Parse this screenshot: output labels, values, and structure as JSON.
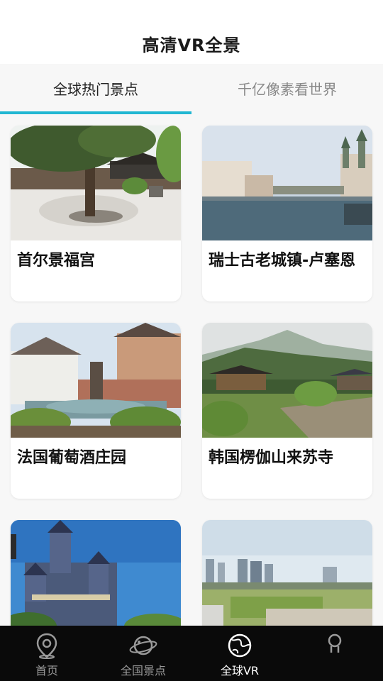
{
  "header": {
    "title": "高清VR全景"
  },
  "tabs": [
    {
      "label": "全球热门景点",
      "active": true
    },
    {
      "label": "千亿像素看世界",
      "active": false
    }
  ],
  "accent_color": "#22b7d2",
  "cards": [
    {
      "name": "首尔景福宫",
      "image": "palace-courtyard-tree-photo"
    },
    {
      "name": "瑞士古老城镇-卢塞恩",
      "image": "lake-town-photo"
    },
    {
      "name": "法国葡萄酒庄园",
      "image": "village-fountain-photo"
    },
    {
      "name": "韩国楞伽山来苏寺",
      "image": "mountain-temple-photo"
    },
    {
      "name": "",
      "image": "fairytale-castle-photo"
    },
    {
      "name": "",
      "image": "city-skyline-photo"
    }
  ],
  "tabbar": {
    "items": [
      {
        "label": "首页",
        "icon": "location-pin-icon",
        "active": false
      },
      {
        "label": "全国景点",
        "icon": "planet-icon",
        "active": false
      },
      {
        "label": "全球VR",
        "icon": "globe-icon",
        "active": true
      },
      {
        "label": "",
        "icon": "person-icon",
        "active": false
      }
    ]
  }
}
